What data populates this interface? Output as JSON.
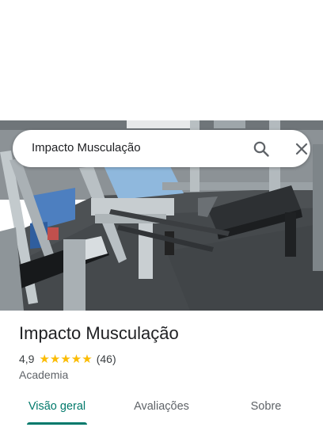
{
  "search": {
    "query": "Impacto Musculação"
  },
  "place": {
    "name": "Impacto Musculação",
    "rating": "4,9",
    "stars": "★★★★★",
    "reviews": "(46)",
    "category": "Academia"
  },
  "tabs": [
    {
      "label": "Visão geral",
      "active": true
    },
    {
      "label": "Avaliações",
      "active": false
    },
    {
      "label": "Sobre",
      "active": false
    }
  ],
  "colors": {
    "accent": "#00796b",
    "star": "#fbbc04"
  }
}
